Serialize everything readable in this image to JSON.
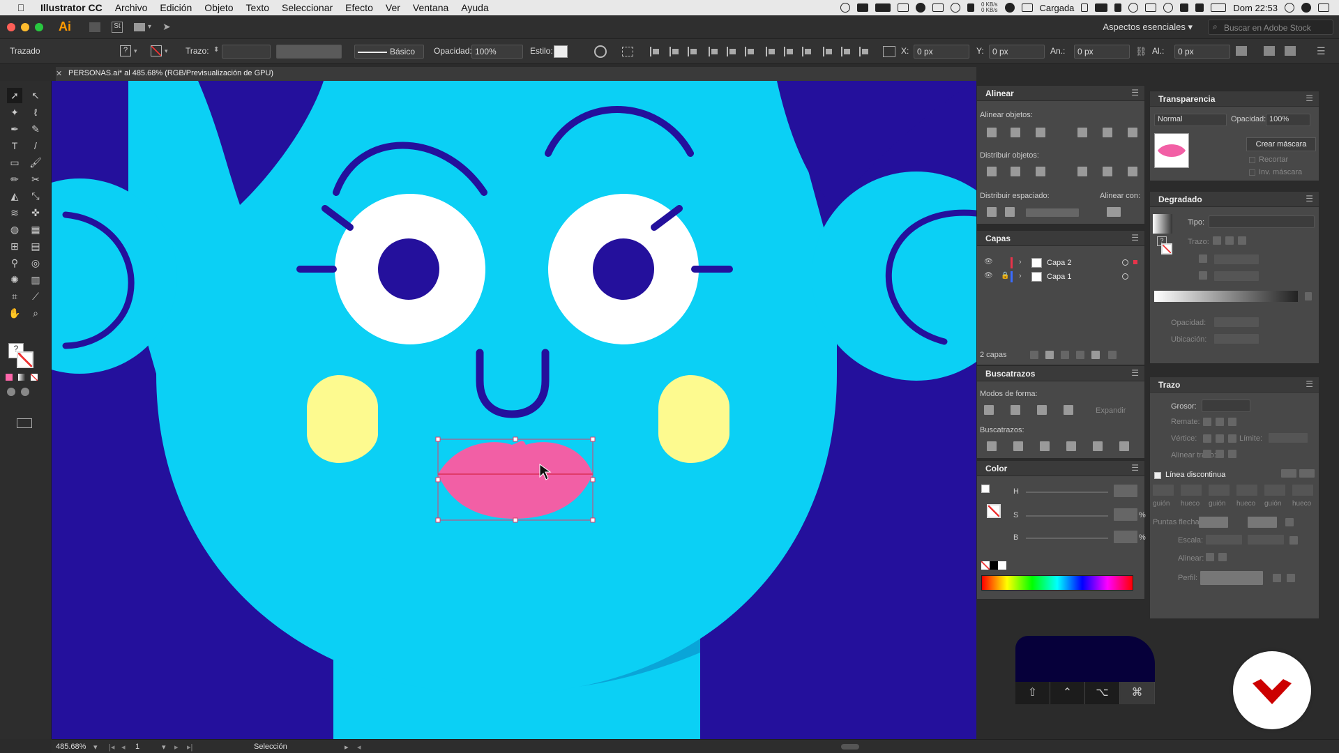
{
  "menubar": {
    "app_name": "Illustrator CC",
    "items": [
      "Archivo",
      "Edición",
      "Objeto",
      "Texto",
      "Seleccionar",
      "Efecto",
      "Ver",
      "Ventana",
      "Ayuda"
    ],
    "status": {
      "net_up": "0 KB/s",
      "net_down": "0 KB/s",
      "battery_text": "Cargada",
      "clock": "Dom 22:53"
    }
  },
  "appbar": {
    "logo": "Ai",
    "st_label": "St",
    "workspace": "Aspectos esenciales",
    "search_placeholder": "Buscar en Adobe Stock"
  },
  "control": {
    "selection_type": "Trazado",
    "stroke_label": "Trazo:",
    "brush_label": "Básico",
    "opacity_label": "Opacidad:",
    "opacity_value": "100%",
    "style_label": "Estilo:",
    "x_label": "X:",
    "x_value": "0 px",
    "y_label": "Y:",
    "y_value": "0 px",
    "w_label": "An.:",
    "w_value": "0 px",
    "h_label": "Al.:",
    "h_value": "0 px"
  },
  "document": {
    "tab_title": "PERSONAS.ai* al 485.68% (RGB/Previsualización de GPU)"
  },
  "panels": {
    "alinear": {
      "title": "Alinear",
      "align_objects": "Alinear objetos:",
      "distribute_objects": "Distribuir objetos:",
      "distribute_spacing": "Distribuir espaciado:",
      "align_to": "Alinear con:"
    },
    "capas": {
      "title": "Capas",
      "layers": [
        {
          "name": "Capa 2",
          "color": "#e8334a",
          "locked": false
        },
        {
          "name": "Capa 1",
          "color": "#3a6cff",
          "locked": true
        }
      ],
      "count": "2 capas"
    },
    "buscatrazos": {
      "title": "Buscatrazos",
      "shape_modes": "Modos de forma:",
      "expand": "Expandir",
      "pathfinders": "Buscatrazos:"
    },
    "color": {
      "title": "Color",
      "h": "H",
      "s": "S",
      "b": "B",
      "pct": "%"
    },
    "transparencia": {
      "title": "Transparencia",
      "blend_mode": "Normal",
      "opacity_label": "Opacidad:",
      "opacity_value": "100%",
      "make_mask": "Crear máscara",
      "clip": "Recortar",
      "invert_mask": "Inv. máscara"
    },
    "degradado": {
      "title": "Degradado",
      "type_label": "Tipo:",
      "stroke_label": "Trazo:",
      "opacity_label": "Opacidad:",
      "location_label": "Ubicación:"
    },
    "trazo": {
      "title": "Trazo",
      "weight": "Grosor:",
      "cap": "Remate:",
      "corner": "Vértice:",
      "limit": "Límite:",
      "align_stroke": "Alinear trazo:",
      "dashed": "Línea discontinua",
      "dash_labels": [
        "guión",
        "hueco",
        "guión",
        "hueco",
        "guión",
        "hueco"
      ],
      "arrowheads": "Puntas flecha:",
      "scale": "Escala:",
      "align": "Alinear:",
      "profile": "Perfil:"
    }
  },
  "modkeys": [
    "⇧",
    "⌃",
    "⌥",
    "⌘"
  ],
  "statusbar": {
    "zoom": "485.68%",
    "artboard": "1",
    "tool": "Selección"
  },
  "colors": {
    "canvas_bg": "#24109c",
    "face": "#0bd0f5",
    "lips": "#f25fa5",
    "cheeks": "#fdfa8f",
    "selection": "#e03b6a"
  }
}
